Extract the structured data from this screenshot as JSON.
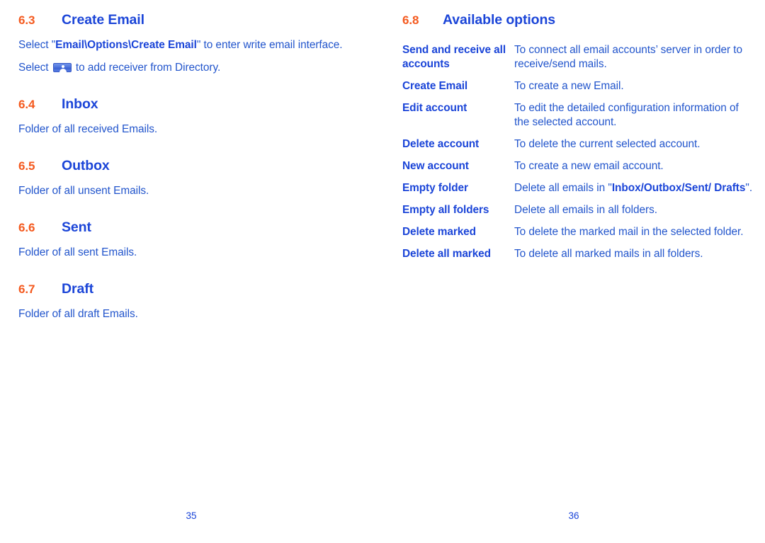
{
  "document": {
    "type": "user-manual-spread"
  },
  "left_page": {
    "folio": "35",
    "sections": [
      {
        "number": "6.3",
        "title": "Create Email",
        "paragraph_1_prefix": "Select \"",
        "paragraph_1_bold": "Email\\Options\\Create Email",
        "paragraph_1_suffix": "\" to enter write email interface.",
        "paragraph_2_prefix": "Select ",
        "paragraph_2_icon": "contact-directory-icon",
        "paragraph_2_suffix": " to add receiver from Directory."
      },
      {
        "number": "6.4",
        "title": "Inbox",
        "body": "Folder of all received Emails."
      },
      {
        "number": "6.5",
        "title": "Outbox",
        "body": "Folder of all unsent Emails."
      },
      {
        "number": "6.6",
        "title": "Sent",
        "body": "Folder of all sent Emails."
      },
      {
        "number": "6.7",
        "title": "Draft",
        "body": "Folder of all draft Emails."
      }
    ]
  },
  "right_page": {
    "folio": "36",
    "section": {
      "number": "6.8",
      "title": "Available options"
    },
    "options": [
      {
        "term": "Send and receive all accounts",
        "desc_prefix": "To connect all email accounts’ server in order to receive/send mails.",
        "desc_bold": "",
        "desc_suffix": ""
      },
      {
        "term": "Create Email",
        "desc_prefix": "To create a new Email.",
        "desc_bold": "",
        "desc_suffix": ""
      },
      {
        "term": "Edit account",
        "desc_prefix": "To edit the detailed configuration information of the selected account.",
        "desc_bold": "",
        "desc_suffix": ""
      },
      {
        "term": "Delete account",
        "desc_prefix": "To delete the current selected account.",
        "desc_bold": "",
        "desc_suffix": ""
      },
      {
        "term": "New account",
        "desc_prefix": "To create a new email account.",
        "desc_bold": "",
        "desc_suffix": ""
      },
      {
        "term": "Empty folder",
        "desc_prefix": "Delete all emails in \"",
        "desc_bold": "Inbox/Outbox/Sent/ Drafts",
        "desc_suffix": "\"."
      },
      {
        "term": "Empty all folders",
        "desc_prefix": "Delete all emails in all folders.",
        "desc_bold": "",
        "desc_suffix": ""
      },
      {
        "term": "Delete marked",
        "desc_prefix": "To delete the marked mail in the selected folder.",
        "desc_bold": "",
        "desc_suffix": ""
      },
      {
        "term": "Delete all marked",
        "desc_prefix": "To delete all marked mails in all folders.",
        "desc_bold": "",
        "desc_suffix": ""
      }
    ]
  },
  "colors": {
    "heading_number": "#f4591e",
    "heading_title": "#1b45d8",
    "body_text": "#2255cc",
    "page_background": "#ffffff"
  }
}
